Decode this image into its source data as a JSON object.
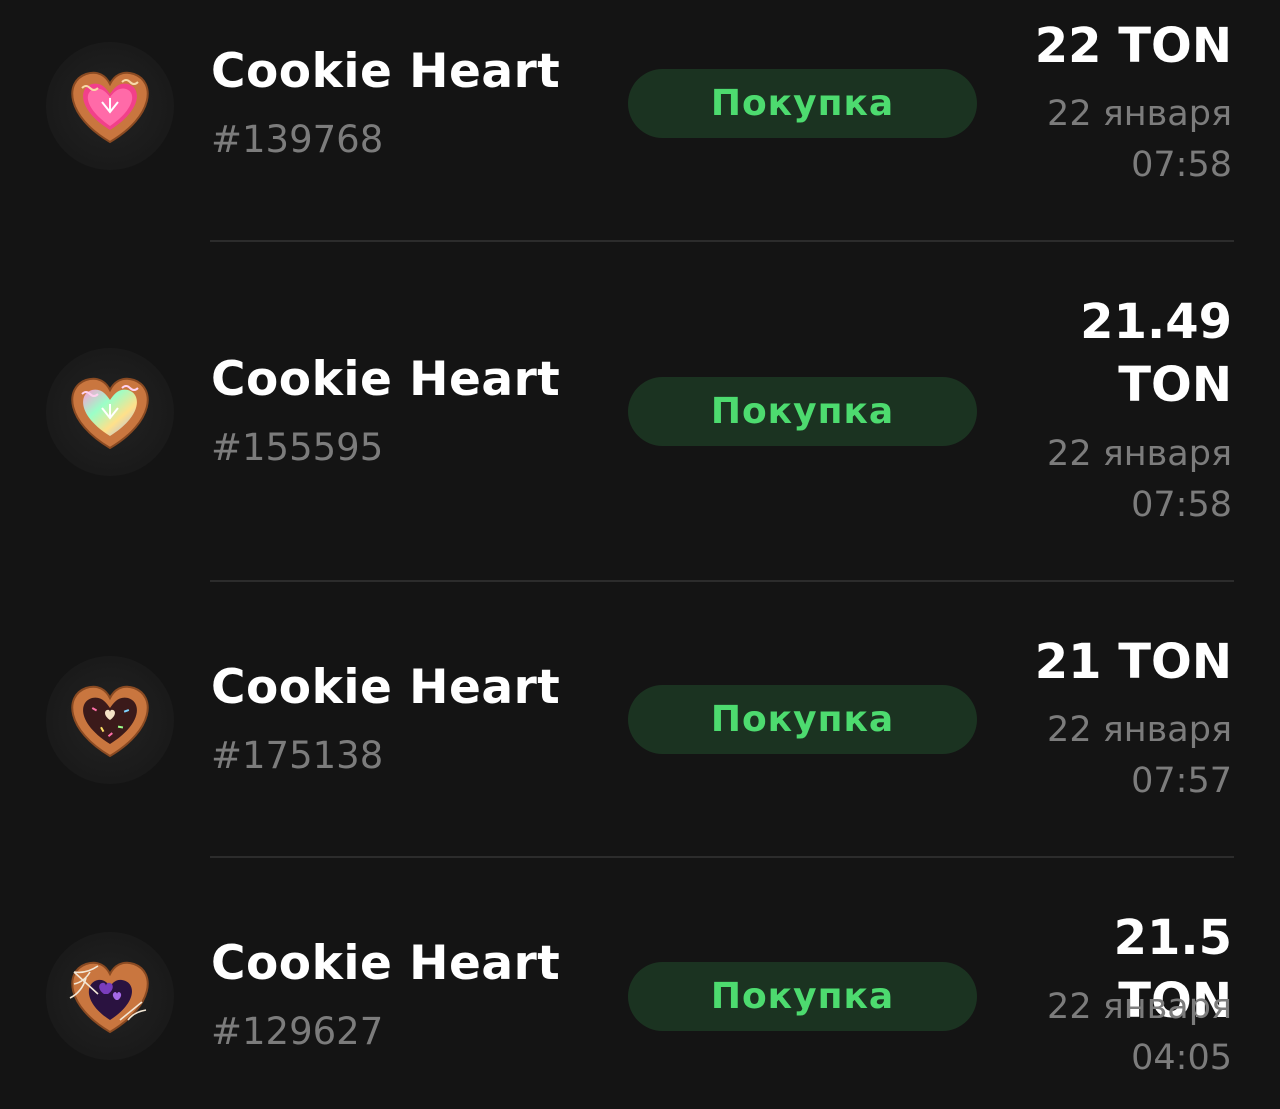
{
  "purchases": [
    {
      "name": "Cookie Heart",
      "number": "#139768",
      "action": "Покупка",
      "price": "22 TON",
      "date": "22 января",
      "time": "07:58",
      "icon": "cookie-heart-pink-icon"
    },
    {
      "name": "Cookie Heart",
      "number": "#155595",
      "action": "Покупка",
      "price": "21.49 TON",
      "date": "22 января",
      "time": "07:58",
      "icon": "cookie-heart-iridescent-icon"
    },
    {
      "name": "Cookie Heart",
      "number": "#175138",
      "action": "Покупка",
      "price": "21 TON",
      "date": "22 января",
      "time": "07:57",
      "icon": "cookie-heart-chocolate-icon"
    },
    {
      "name": "Cookie Heart",
      "number": "#129627",
      "action": "Покупка",
      "price": "21.5 TON",
      "date": "22 января",
      "time": "04:05",
      "icon": "cookie-heart-web-icon"
    }
  ],
  "colors": {
    "background": "#141414",
    "action_bg": "#1b3321",
    "action_text": "#4ddb6f",
    "secondary_text": "#7c7c7c"
  }
}
